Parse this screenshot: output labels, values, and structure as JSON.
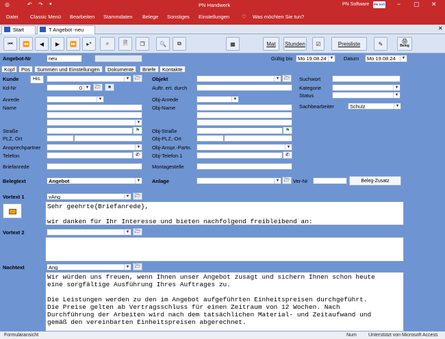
{
  "titlebar": {
    "title": "PN Handwerk",
    "brand": "PN Software",
    "brand_badge": "PN Soft"
  },
  "menu": {
    "items": [
      "Datei",
      "Classic Menü",
      "Bearbeiten",
      "Stammdaten",
      "Belege",
      "Sonstiges",
      "Einstellungen"
    ],
    "search_hint": "Was möchten Sie tun?"
  },
  "doc_tabs": [
    {
      "label": "Start"
    },
    {
      "label": "T Angebot -neu"
    }
  ],
  "toolbar": {
    "mat": "Mat",
    "stunden": "Stunden",
    "preisliste": "Preisliste",
    "beleg": "Beleg"
  },
  "header": {
    "angebot_nr_label": "Angebot-Nr",
    "angebot_nr_value": "neu",
    "gueltig_label": "Gültig bis",
    "gueltig_value": "Mo 19.08.24",
    "datum_label": "Datum",
    "datum_value": "Mo 19.08.24"
  },
  "form_tabs": [
    "Kopf",
    "Pos",
    "Summen und Einstellungen",
    "Dokumente",
    "Briefe",
    "Kontakte"
  ],
  "kunde": {
    "kunde_label": "Kunde",
    "his_button": "His.",
    "kdnr_label": "Kd-Nr",
    "kdnr_value": "0",
    "anrede_label": "Anrede",
    "name_label": "Name",
    "strasse_label": "Straße",
    "plz_label": "PLZ, Ort",
    "ansprech_label": "Ansprechpartner",
    "telefon_label": "Telefon",
    "briefanrede_label": "Briefanrede"
  },
  "objekt": {
    "objekt_label": "Objekt",
    "auftr_label": "Auftr. ert. durch",
    "anrede_label": "Obj-Anrede",
    "name_label": "Obj-Name",
    "strasse_label": "Obj-Straße",
    "plz_label": "Obj-PLZ,-Ort",
    "ansp_label": "Obj-Anspr.-Partn.",
    "tel_label": "Obj-Telefon 1",
    "montage_label": "Montagestelle"
  },
  "right": {
    "suchwort_label": "Suchwort",
    "kategorie_label": "Kategorie",
    "status_label": "Status",
    "sachbearbeiter_label": "Sachbearbeiter",
    "sachbearbeiter_value": "Schulz"
  },
  "belegtext": {
    "label": "Belegtext",
    "value": "Angebot",
    "anlage_label": "Anlage",
    "vernr_label": "Ver-Nr",
    "zusatz_button": "Beleg-Zusatz"
  },
  "vortext1": {
    "label": "Vortext 1",
    "code": "vAng",
    "lines": [
      "Sehr geehrte{Briefanrede},",
      "",
      "wir danken für Ihr Interesse und bieten nachfolgend freibleibend an:"
    ]
  },
  "vortext2": {
    "label": "Vortext 2"
  },
  "nachtext": {
    "label": "Nachtext",
    "code": "Ang",
    "lines": [
      "Wir würden uns freuen, wenn Ihnen unser Angebot zusagt und sichern Ihnen schon heute",
      "eine sorgfältige Ausführung Ihres Auftrages zu.",
      "",
      "Die Leistungen werden zu den im Angebot aufgeführten Einheitspreisen durchgeführt.",
      "Die Preise gelten ab Vertragsschluss für einen Zeitraum von 12 Wochen. Nach",
      "Durchführung der Arbeiten wird nach dem tatsächlichen Material- und Zeitaufwand und",
      "gemäß den vereinbarten Einheitspreisen abgerechnet."
    ]
  },
  "status": {
    "left": "Formularansicht",
    "num": "Num",
    "right": "Unterstützt von Microsoft Access"
  },
  "colors": {
    "accent": "#c62a2a",
    "form_bg": "#6e94d2"
  }
}
